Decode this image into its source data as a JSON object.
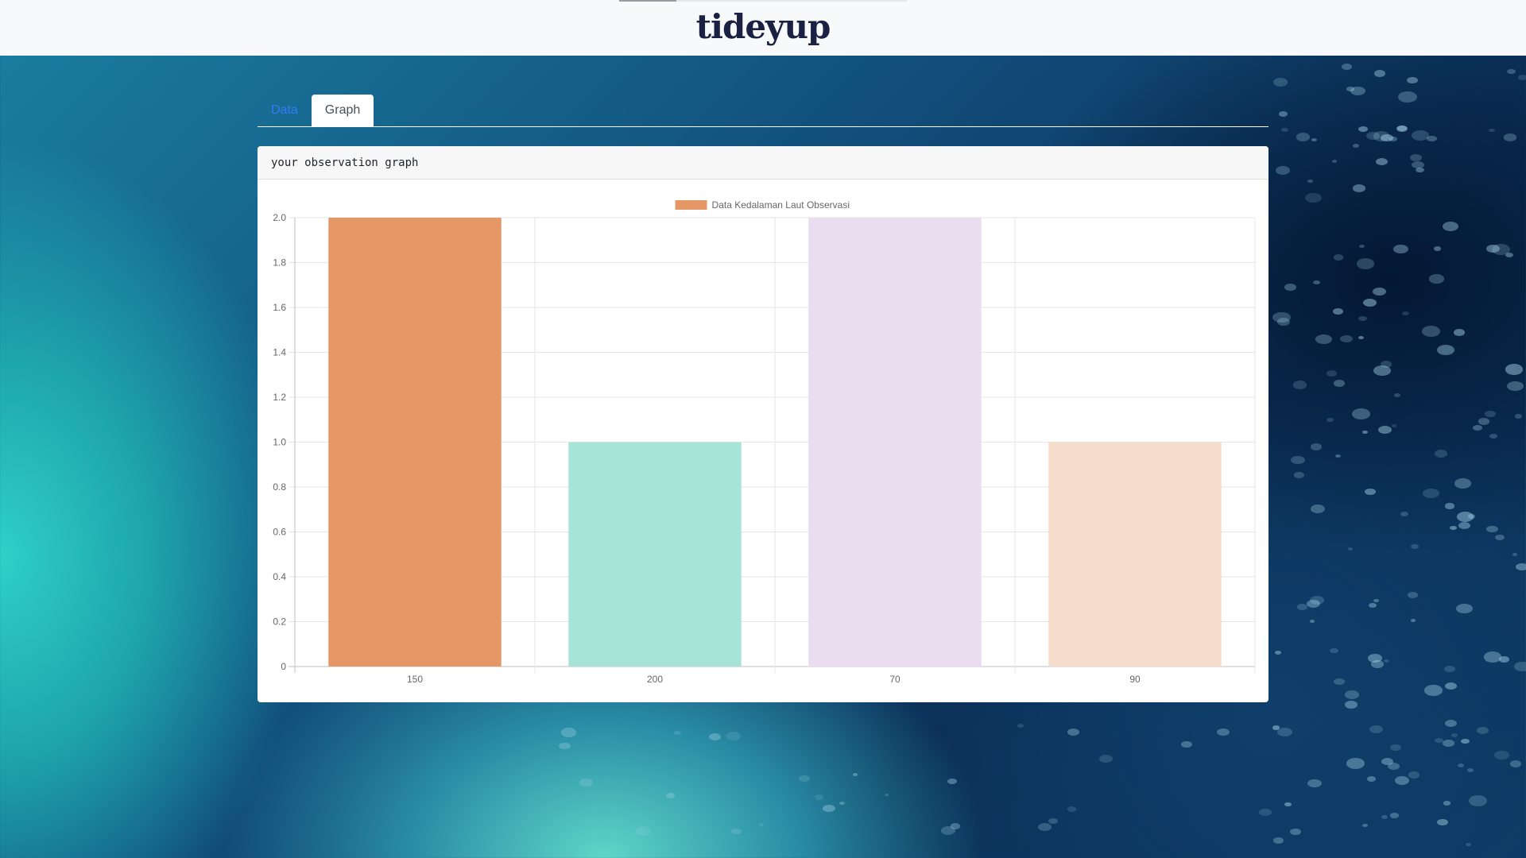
{
  "app": {
    "brand": "tideyup"
  },
  "tabs": [
    {
      "label": "Data",
      "active": false
    },
    {
      "label": "Graph",
      "active": true
    }
  ],
  "card": {
    "title": "your observation graph"
  },
  "chart_data": {
    "type": "bar",
    "categories": [
      "150",
      "200",
      "70",
      "90"
    ],
    "series": [
      {
        "name": "Data Kedalaman Laut Observasi",
        "values": [
          2,
          1,
          2,
          1
        ]
      }
    ],
    "bar_colors": [
      "#e59866",
      "#a7e4d8",
      "#e9ddef",
      "#f6dcca"
    ],
    "legend_color": "#e59866",
    "ylim": [
      0,
      2
    ],
    "yticks": [
      "0",
      "0.2",
      "0.4",
      "0.6",
      "0.8",
      "1.0",
      "1.2",
      "1.4",
      "1.6",
      "1.8",
      "2.0"
    ],
    "legend_position": "top",
    "grid": true
  }
}
